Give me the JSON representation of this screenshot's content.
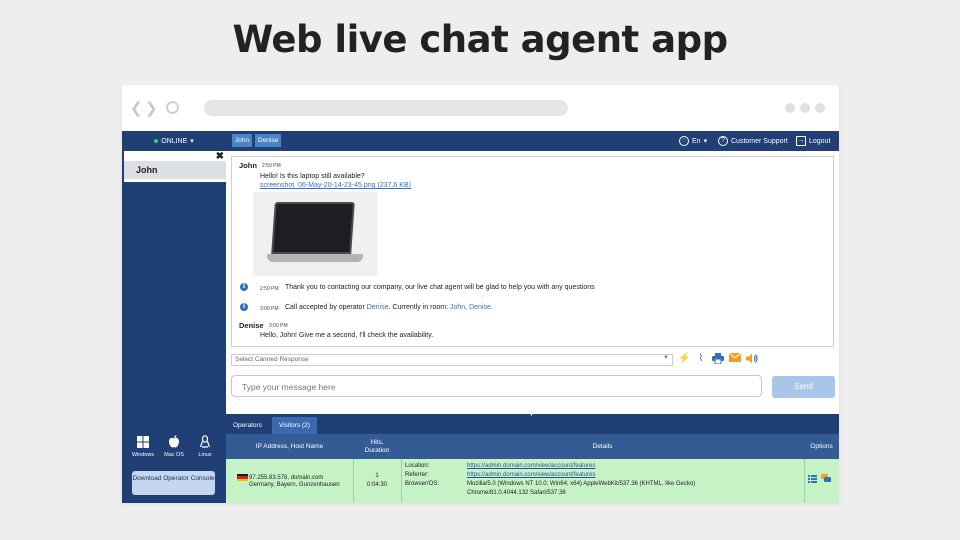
{
  "page_title": "Web live chat agent app",
  "sidebar": {
    "status": "ONLINE",
    "status_caret": "▾",
    "close_glyph": "✖",
    "chat_item": "John",
    "os": [
      {
        "label": "Windows",
        "icon": "windows-icon"
      },
      {
        "label": "Mac OS",
        "icon": "apple-icon"
      },
      {
        "label": "Linux",
        "icon": "linux-icon"
      }
    ],
    "download_button": "Download Operator Console"
  },
  "topbar": {
    "rooms": [
      "John",
      "Denise"
    ],
    "language": "En",
    "language_caret": "▾",
    "support": "Customer Support",
    "logout": "Logout"
  },
  "messages": {
    "m1": {
      "name": "John",
      "time": "2:59 PM",
      "text": "Hello! Is this laptop still available?",
      "link": "screenshot_06-May-20-14-23-45.png (237.6 KB)"
    },
    "m2": {
      "time": "2:59 PM",
      "text": "Thank you to contacting our company, our live chat agent will be glad to help you with any questions"
    },
    "m3": {
      "time": "3:00 PM",
      "text_a": "Call accepted by operator ",
      "op": "Denise",
      "text_b": ". Currently in room: ",
      "r1": "John",
      "sep": ", ",
      "r2": "Denise",
      "end": "."
    },
    "m4": {
      "name": "Denise",
      "time": "3:00 PM",
      "text": "Hello, John! Give me a second, I'll check the availability."
    }
  },
  "composer": {
    "canned_placeholder": "Select Canned Response",
    "message_placeholder": "Type your message here",
    "send": "Send"
  },
  "bottom": {
    "tabs": [
      "Operators",
      "Visitors (2)"
    ],
    "columns": {
      "ip_host": "IP Address, Host Name",
      "hits_a": "Hits,",
      "hits_b": "Duration",
      "details": "Details",
      "options": "Options"
    },
    "visitor": {
      "flag_colors": [
        "#1a1a1a",
        "#d21f1f",
        "#f2c200"
      ],
      "ip_host": "97.255.83.578, domain.com",
      "location": "Germany, Bayern, Gunzenhausen",
      "hits": "1",
      "duration": "0:04:30",
      "location_label": "Location:",
      "location_url": "https://admin.domain.com/view/account/features",
      "referrer_label": "Referrer:",
      "referrer_url": "https://admin.domain.com/view/account/features",
      "browser_label": "Browser/OS:",
      "browser_a": "Mozilla/5.0 (Windows NT 10.0; Win64; x64) AppleWebKit/537.36 (KHTML, like Gecko)",
      "browser_b": "Chrome/81.0.4044.132 Safari/537.36"
    }
  },
  "colors": {
    "sidebar": "#203f74",
    "accent": "#3173c7",
    "visitor_row": "#c5f3c5",
    "send": "#a9c6ea"
  }
}
